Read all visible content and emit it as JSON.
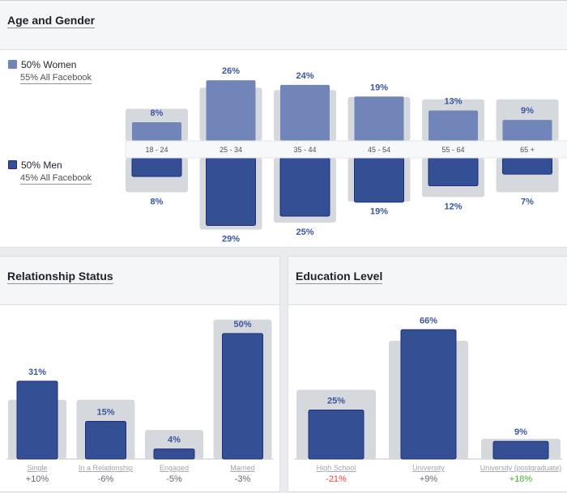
{
  "colors": {
    "women": "#7185b8",
    "men": "#354f95",
    "men_border": "#1e2e7a",
    "comparison": "#d5d8dd",
    "value_label": "#3b56a0",
    "negative": "#fa3e3e",
    "positive": "#42b72a",
    "neutral": "#606770"
  },
  "age_gender": {
    "title": "Age and Gender",
    "legend": [
      {
        "label": "50% Women",
        "sub": "55% All Facebook"
      },
      {
        "label": "50% Men",
        "sub": "45% All Facebook"
      }
    ]
  },
  "relationship": {
    "title": "Relationship Status"
  },
  "education": {
    "title": "Education Level"
  },
  "chart_data": [
    {
      "type": "bar",
      "title": "Age and Gender",
      "categories": [
        "18 - 24",
        "25 - 34",
        "35 - 44",
        "45 - 54",
        "55 - 64",
        "65 +"
      ],
      "series": [
        {
          "name": "Women",
          "values": [
            8,
            26,
            24,
            19,
            13,
            9
          ],
          "labels": [
            "8%",
            "26%",
            "24%",
            "19%",
            "13%",
            "9%"
          ],
          "all_facebook_estimate": [
            11,
            20,
            19,
            16,
            15,
            15
          ]
        },
        {
          "name": "Men",
          "values": [
            8,
            29,
            25,
            19,
            12,
            7
          ],
          "labels": [
            "8%",
            "29%",
            "25%",
            "19%",
            "12%",
            "7%"
          ],
          "all_facebook_estimate": [
            12,
            28,
            25,
            16,
            14,
            12
          ]
        }
      ],
      "legend_position": "left"
    },
    {
      "type": "bar",
      "title": "Relationship Status",
      "categories": [
        "Single",
        "In a Relationship",
        "Engaged",
        "Married"
      ],
      "values": [
        31,
        15,
        4,
        50
      ],
      "labels": [
        "31%",
        "15%",
        "4%",
        "50%"
      ],
      "all_facebook_estimate": [
        21,
        21,
        9,
        53
      ],
      "differences": [
        "+10%",
        "-6%",
        "-5%",
        "-3%"
      ],
      "difference_tone": [
        "neutral",
        "neutral",
        "neutral",
        "neutral"
      ]
    },
    {
      "type": "bar",
      "title": "Education Level",
      "categories": [
        "High School",
        "University",
        "University (postgraduate)"
      ],
      "values": [
        25,
        66,
        9
      ],
      "labels": [
        "25%",
        "66%",
        "9%"
      ],
      "all_facebook_estimate": [
        32,
        57,
        7
      ],
      "differences": [
        "-21%",
        "+9%",
        "+18%"
      ],
      "difference_tone": [
        "negative",
        "neutral",
        "positive"
      ]
    }
  ]
}
